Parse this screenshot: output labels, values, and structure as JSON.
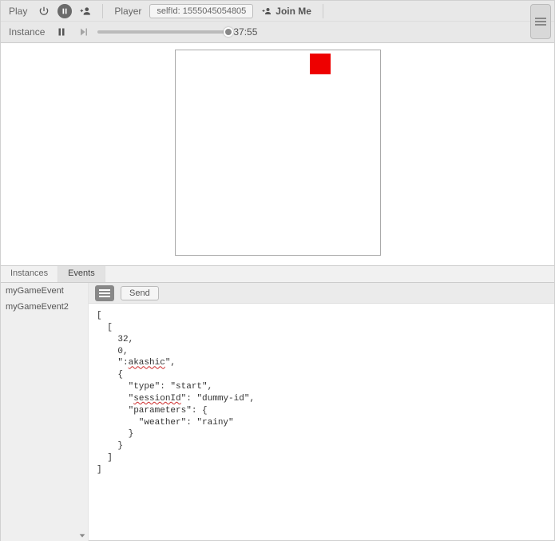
{
  "toolbar": {
    "play_label": "Play",
    "player_label": "Player",
    "self_id_text": "selfId: 1555045054805",
    "join_me_label": "Join Me",
    "instance_label": "Instance",
    "time": "37:55"
  },
  "canvas": {
    "block_color": "#ee0000"
  },
  "tabs": {
    "items": [
      "Instances",
      "Events"
    ],
    "active_index": 1
  },
  "sidebar": {
    "items": [
      "myGameEvent",
      "myGameEvent2"
    ]
  },
  "event_toolbar": {
    "send_label": "Send"
  },
  "event_body": {
    "line1": "[",
    "line2": "  [",
    "line3": "    32,",
    "line4": "    0,",
    "line5a": "    \":",
    "line5b": "akashic",
    "line5c": "\",",
    "line6": "    {",
    "line7": "      \"type\": \"start\",",
    "line8a": "      \"",
    "line8b": "sessionId",
    "line8c": "\": \"dummy-id\",",
    "line9": "      \"parameters\": {",
    "line10": "        \"weather\": \"rainy\"",
    "line11": "      }",
    "line12": "    }",
    "line13": "  ]",
    "line14": "]"
  }
}
